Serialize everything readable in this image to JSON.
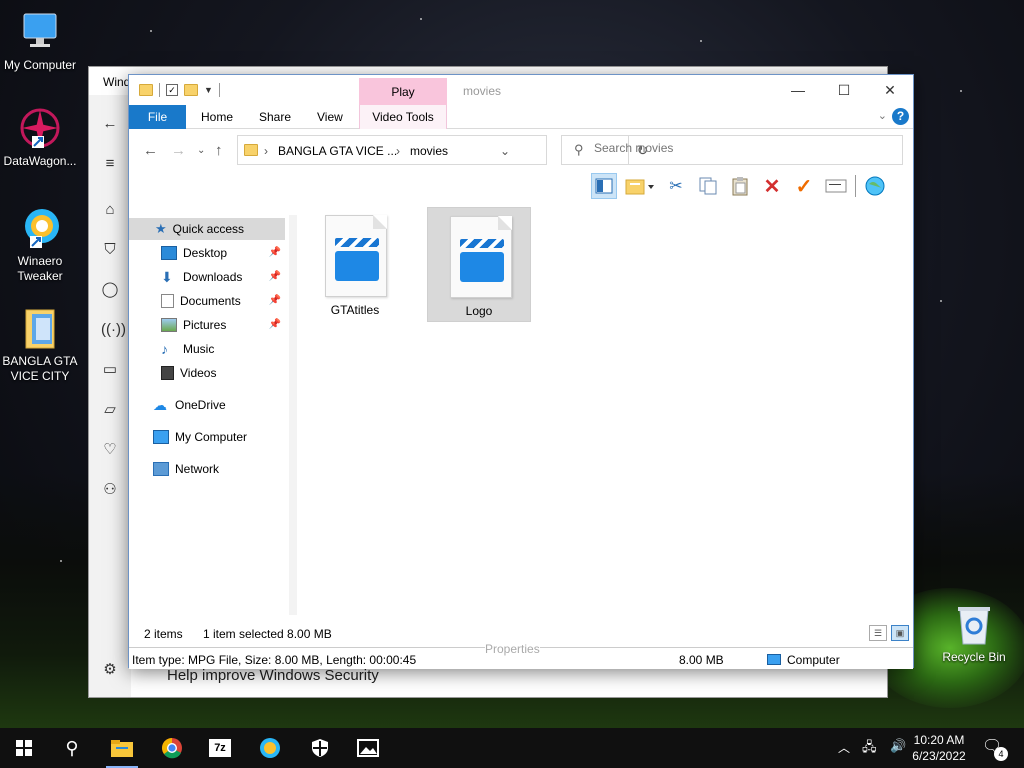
{
  "desktop": {
    "icons": [
      {
        "label": "My Computer",
        "icon": "computer-icon"
      },
      {
        "label": "DataWagon...",
        "icon": "datawagon-icon"
      },
      {
        "label": "Winaero Tweaker",
        "icon": "winaero-icon"
      },
      {
        "label": "BANGLA GTA VICE CITY",
        "icon": "folder-icon"
      },
      {
        "label": "Recycle Bin",
        "icon": "recycle-bin-icon"
      }
    ]
  },
  "back_window": {
    "title": "Wind",
    "help_text": "Help improve Windows Security"
  },
  "explorer": {
    "title": "movies",
    "contextual_tab": "Play",
    "ribbon_tabs": [
      "File",
      "Home",
      "Share",
      "View",
      "Video Tools"
    ],
    "address": {
      "parent": "BANGLA GTA VICE ...",
      "current": "movies"
    },
    "search_placeholder": "Search movies",
    "toolbar_icons": [
      "preview-pane-icon",
      "new-folder-icon",
      "cut-icon",
      "copy-icon",
      "paste-icon",
      "delete-icon",
      "checkmark-icon",
      "rename-icon",
      "globe-icon"
    ],
    "nav": {
      "quick_access": "Quick access",
      "items": [
        "Desktop",
        "Downloads",
        "Documents",
        "Pictures",
        "Music",
        "Videos"
      ],
      "onedrive": "OneDrive",
      "my_computer": "My Computer",
      "network": "Network"
    },
    "files": [
      {
        "name": "GTAtitles",
        "selected": false
      },
      {
        "name": "Logo",
        "selected": true
      }
    ],
    "status": {
      "count": "2 items",
      "selection": "1 item selected  8.00 MB"
    },
    "properties": {
      "header": "Properties",
      "details": "Item type: MPG File, Size: 8.00 MB, Length: 00:00:45",
      "size": "8.00 MB",
      "location": "Computer"
    }
  },
  "taskbar": {
    "apps": [
      "file-explorer-icon",
      "chrome-icon",
      "7zip-icon",
      "winaero-icon",
      "windows-security-icon",
      "photos-icon"
    ],
    "time": "10:20 AM",
    "date": "6/23/2022",
    "notification_count": "4"
  }
}
